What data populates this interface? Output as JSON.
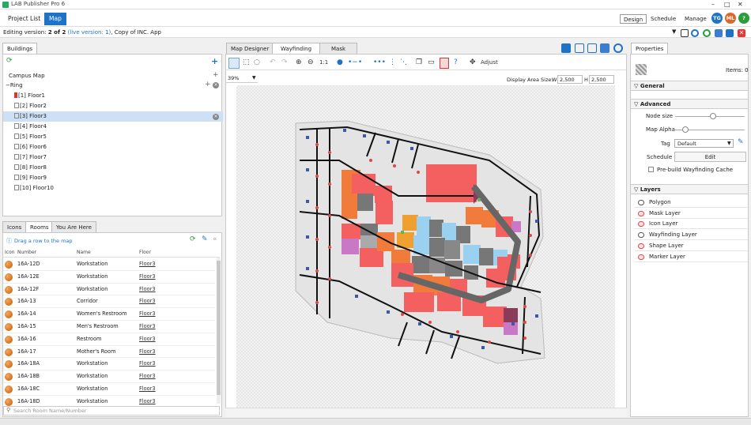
{
  "app": {
    "title": "LAB Publisher Pro 6"
  },
  "nav": {
    "project_list": "Project List",
    "map": "Map"
  },
  "right_nav": {
    "design": "Design",
    "schedule": "Schedule",
    "manage": "Manage"
  },
  "avatars": [
    {
      "initials": "TG",
      "color": "#1e73c8"
    },
    {
      "initials": "ML",
      "color": "#e0672a"
    },
    {
      "initials": "?",
      "color": "#2a9d3c"
    }
  ],
  "version": {
    "prefix": "Editing version:",
    "current": "2 of 2",
    "live": "(live version: 1)",
    "suffix": "Copy of INC. App"
  },
  "buildings": {
    "tab": "Buildings",
    "campus": "Campus Map",
    "building": "Ring",
    "floors": [
      "[1] Floor1",
      "[2] Floor2",
      "[3] Floor3",
      "[4] Floor4",
      "[5] Floor5",
      "[6] Floor6",
      "[7] Floor7",
      "[8] Floor8",
      "[9] Floor9",
      "[10] Floor10"
    ],
    "selected_floor": "[3] Floor3"
  },
  "rooms": {
    "tabs": [
      "Icons",
      "Rooms",
      "You Are Here"
    ],
    "active_tab": "Rooms",
    "hint": "Drag a row to the map",
    "columns": [
      "Icon",
      "Number",
      "Name",
      "Floor"
    ],
    "rows": [
      {
        "number": "16A-12D",
        "name": "Workstation",
        "floor": "Floor3"
      },
      {
        "number": "16A-12E",
        "name": "Workstation",
        "floor": "Floor3"
      },
      {
        "number": "16A-12F",
        "name": "Workstation",
        "floor": "Floor3"
      },
      {
        "number": "16A-13",
        "name": "Corridor",
        "floor": "Floor3"
      },
      {
        "number": "16A-14",
        "name": "Women's Restroom",
        "floor": "Floor3"
      },
      {
        "number": "16A-15",
        "name": "Men's Restroom",
        "floor": "Floor3"
      },
      {
        "number": "16A-16",
        "name": "Restroom",
        "floor": "Floor3"
      },
      {
        "number": "16A-17",
        "name": "Mother's Room",
        "floor": "Floor3"
      },
      {
        "number": "16A-18A",
        "name": "Workstation",
        "floor": "Floor3"
      },
      {
        "number": "16A-18B",
        "name": "Workstation",
        "floor": "Floor3"
      },
      {
        "number": "16A-18C",
        "name": "Workstation",
        "floor": "Floor3"
      },
      {
        "number": "16A-18D",
        "name": "Workstation",
        "floor": "Floor3"
      }
    ],
    "search_placeholder": "Search Room Name/Number"
  },
  "designer": {
    "tabs": [
      "Map Designer",
      "Wayfinding",
      "Mask"
    ],
    "active_tab": "Wayfinding",
    "zoom": "39%",
    "ratio": "1:1",
    "adjust": "Adjust",
    "display_area_label": "Display Area Size:",
    "width_label": "W",
    "width": "2,500",
    "height_label": "H",
    "height": "2,500"
  },
  "properties": {
    "tab": "Properties",
    "items": "Items: 0",
    "general": "General",
    "advanced": "Advanced",
    "node_size": "Node size",
    "map_alpha": "Map Alpha",
    "node_size_level": 0.55,
    "map_alpha_level": 0.15,
    "tag_label": "Tag",
    "tag_value": "Default",
    "schedule_label": "Schedule",
    "edit_button": "Edit",
    "prebuild": "Pre-build Wayfinding Cache",
    "layers_title": "Layers",
    "layers": [
      {
        "name": "Polygon",
        "visible": true
      },
      {
        "name": "Mask Layer",
        "visible": false
      },
      {
        "name": "Icon Layer",
        "visible": false
      },
      {
        "name": "Wayfinding Layer",
        "visible": true
      },
      {
        "name": "Shape Layer",
        "visible": false
      },
      {
        "name": "Marker Layer",
        "visible": false
      }
    ]
  }
}
